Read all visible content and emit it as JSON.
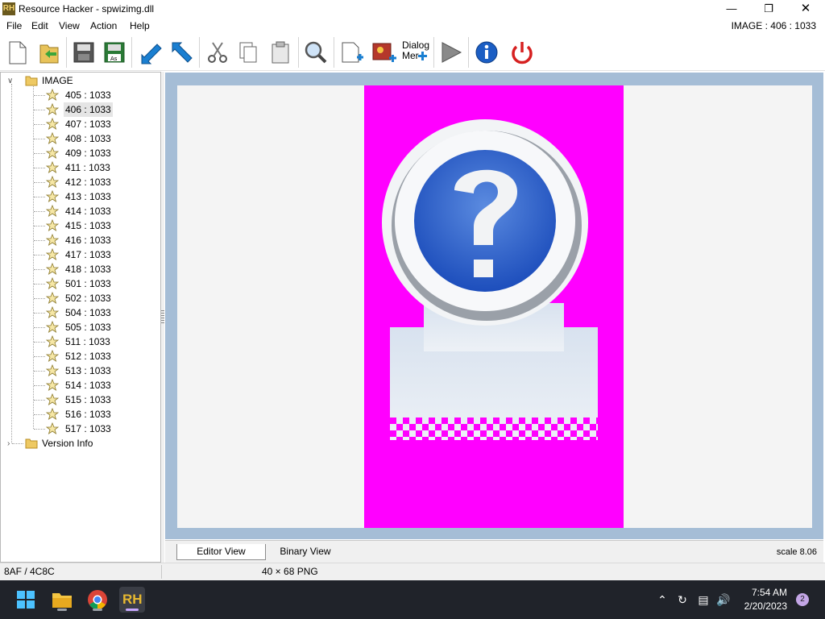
{
  "window": {
    "title": "Resource Hacker - spwizimg.dll",
    "app_icon_text": "RH",
    "resource_id": "IMAGE : 406 : 1033"
  },
  "menu": [
    "File",
    "Edit",
    "View",
    "Action",
    "Help"
  ],
  "toolbar": {
    "items": [
      "new-file-icon",
      "open-folder-icon",
      "save-icon",
      "save-as-icon",
      "import-arrow-icon",
      "export-arrow-icon",
      "cut-icon",
      "copy-icon",
      "paste-icon",
      "search-icon",
      "add-resource-icon",
      "add-image-icon",
      "dialog-merger-icon",
      "run-script-icon",
      "info-icon",
      "power-icon"
    ],
    "dialog_merger_line1": "Dialog",
    "dialog_merger_line2": "Mer"
  },
  "tree": {
    "root_label": "IMAGE",
    "children": [
      "405 : 1033",
      "406 : 1033",
      "407 : 1033",
      "408 : 1033",
      "409 : 1033",
      "411 : 1033",
      "412 : 1033",
      "413 : 1033",
      "414 : 1033",
      "415 : 1033",
      "416 : 1033",
      "417 : 1033",
      "418 : 1033",
      "501 : 1033",
      "502 : 1033",
      "504 : 1033",
      "505 : 1033",
      "511 : 1033",
      "512 : 1033",
      "513 : 1033",
      "514 : 1033",
      "515 : 1033",
      "516 : 1033",
      "517 : 1033"
    ],
    "selected": "406 : 1033",
    "second_root_label": "Version Info"
  },
  "viewer": {
    "image_background": "#ff00ff",
    "tabs": [
      "Editor View",
      "Binary View"
    ],
    "active_tab": "Editor View",
    "scale": "scale 8.06"
  },
  "status": {
    "offset": "8AF / 4C8C",
    "size": "40 × 68  PNG"
  },
  "taskbar": {
    "apps": [
      "windows-start-icon",
      "file-explorer-icon",
      "chrome-icon",
      "resource-hacker-icon"
    ],
    "rh_label": "RH",
    "tray": [
      "chevron-up-icon",
      "sync-icon",
      "network-icon",
      "volume-icon"
    ],
    "time": "7:54 AM",
    "date": "2/20/2023",
    "notification_count": "2"
  },
  "colors": {
    "viewer_border": "#a5bdd6",
    "accent_blue": "#1a7fd1",
    "taskbar": "#20232a"
  }
}
